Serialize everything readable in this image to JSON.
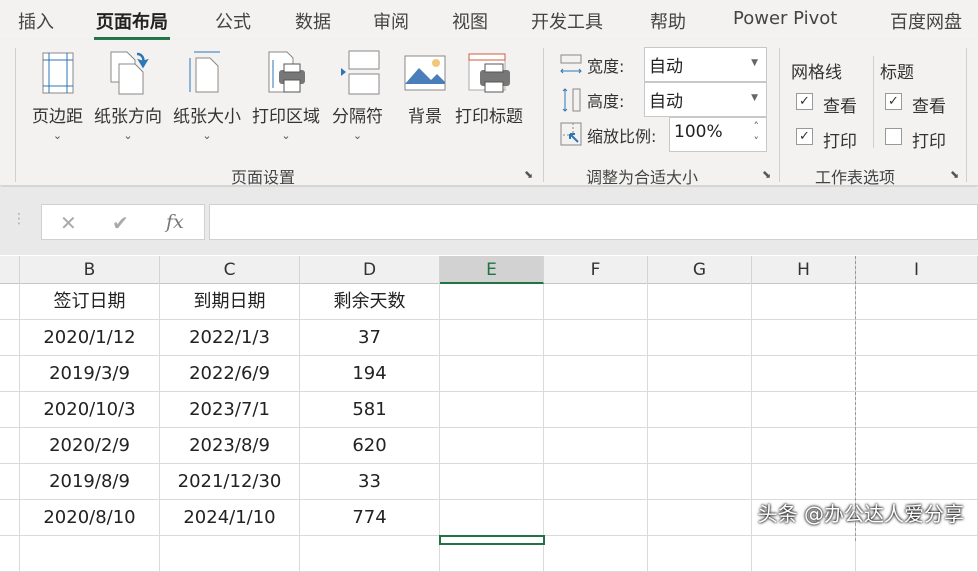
{
  "tabs": [
    "插入",
    "页面布局",
    "公式",
    "数据",
    "审阅",
    "视图",
    "开发工具",
    "帮助",
    "Power Pivot",
    "百度网盘"
  ],
  "active_tab": "页面布局",
  "page_setup": {
    "buttons": [
      "页边距",
      "纸张方向",
      "纸张大小",
      "打印区域",
      "分隔符",
      "背景",
      "打印标题"
    ],
    "group_label": "页面设置"
  },
  "scale_to_fit": {
    "width_label": "宽度:",
    "width_value": "自动",
    "height_label": "高度:",
    "height_value": "自动",
    "scale_label": "缩放比例:",
    "scale_value": "100%",
    "group_label": "调整为合适大小"
  },
  "sheet_options": {
    "gridlines_label": "网格线",
    "headings_label": "标题",
    "view_label": "查看",
    "print_label": "打印",
    "gridlines_view": true,
    "gridlines_print": true,
    "headings_view": true,
    "headings_print": false,
    "group_label": "工作表选项"
  },
  "formula_bar": {
    "cancel": "✕",
    "enter": "✔",
    "fx": "fx",
    "value": ""
  },
  "columns": [
    "B",
    "C",
    "D",
    "E",
    "F",
    "G",
    "H",
    "I"
  ],
  "selected_column": "E",
  "rows": [
    [
      "签订日期",
      "到期日期",
      "剩余天数"
    ],
    [
      "2020/1/12",
      "2022/1/3",
      "37"
    ],
    [
      "2019/3/9",
      "2022/6/9",
      "194"
    ],
    [
      "2020/10/3",
      "2023/7/1",
      "581"
    ],
    [
      "2020/2/9",
      "2023/8/9",
      "620"
    ],
    [
      "2019/8/9",
      "2021/12/30",
      "33"
    ],
    [
      "2020/8/10",
      "2024/1/10",
      "774"
    ]
  ],
  "watermark": "头条 @办公达人爱分享",
  "colors": {
    "accent": "#217346"
  }
}
